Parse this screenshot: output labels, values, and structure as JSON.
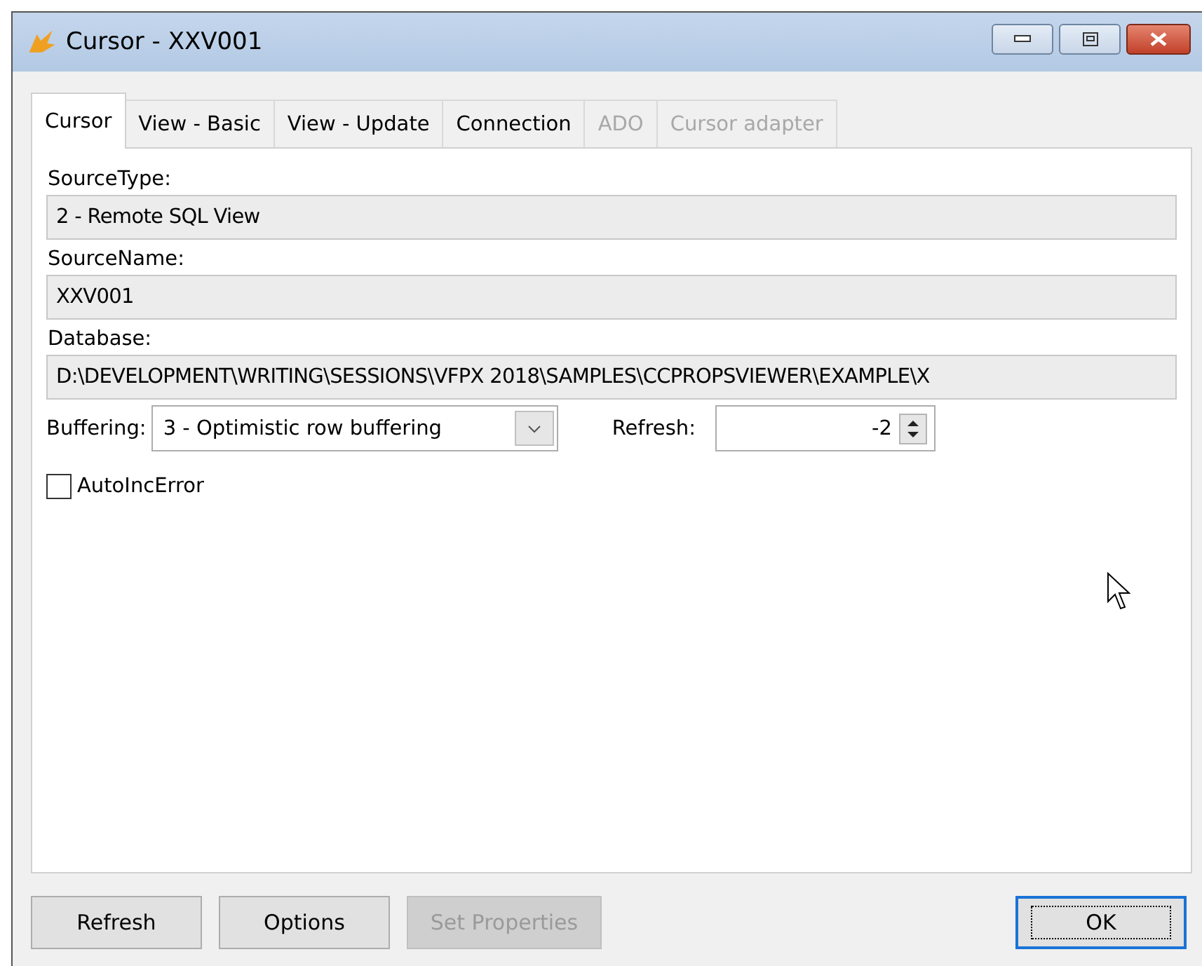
{
  "window": {
    "title": "Cursor - XXV001"
  },
  "tabs": [
    {
      "label": "Cursor",
      "selected": true,
      "disabled": false
    },
    {
      "label": "View - Basic",
      "selected": false,
      "disabled": false
    },
    {
      "label": "View - Update",
      "selected": false,
      "disabled": false
    },
    {
      "label": "Connection",
      "selected": false,
      "disabled": false
    },
    {
      "label": "ADO",
      "selected": false,
      "disabled": true
    },
    {
      "label": "Cursor adapter",
      "selected": false,
      "disabled": true
    }
  ],
  "fields": [
    {
      "label": "SourceType:",
      "value": "2 - Remote SQL View"
    },
    {
      "label": "SourceName:",
      "value": "XXV001"
    },
    {
      "label": "Database:",
      "value": "D:\\DEVELOPMENT\\WRITING\\SESSIONS\\VFPX 2018\\SAMPLES\\CCPROPSVIEWER\\EXAMPLE\\X"
    }
  ],
  "buffering": {
    "label": "Buffering:",
    "value": "3 - Optimistic row buffering"
  },
  "refresh": {
    "label": "Refresh:",
    "value": "-2"
  },
  "auto_inc_error": {
    "label": "AutoIncError",
    "checked": false
  },
  "buttons": [
    {
      "label": "Refresh",
      "disabled": false,
      "default": false
    },
    {
      "label": "Options",
      "disabled": false,
      "default": false
    },
    {
      "label": "Set Properties",
      "disabled": true,
      "default": false
    },
    {
      "label": "OK",
      "disabled": false,
      "default": true
    }
  ]
}
